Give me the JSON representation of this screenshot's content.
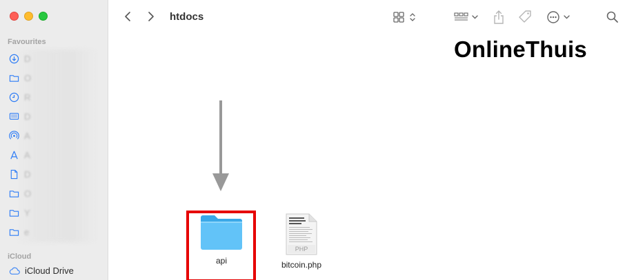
{
  "window": {
    "folder_title": "htdocs"
  },
  "sidebar": {
    "favourites_label": "Favourites",
    "items": [
      {
        "icon": "download-icon",
        "label": "D"
      },
      {
        "icon": "folder-icon",
        "label": "O"
      },
      {
        "icon": "clock-icon",
        "label": "R"
      },
      {
        "icon": "desktop-icon",
        "label": "D"
      },
      {
        "icon": "airdrop-icon",
        "label": "A"
      },
      {
        "icon": "applications-icon",
        "label": "A"
      },
      {
        "icon": "document-icon",
        "label": "D"
      },
      {
        "icon": "folder-icon",
        "label": "O"
      },
      {
        "icon": "folder-icon",
        "label": "Y"
      },
      {
        "icon": "folder-icon",
        "label": "e"
      }
    ],
    "icloud_label": "iCloud",
    "icloud_drive_label": "iCloud Drive"
  },
  "overlay": {
    "brand": "OnlineThuis"
  },
  "files": [
    {
      "name": "api",
      "type": "folder",
      "highlighted": true
    },
    {
      "name": "bitcoin.php",
      "type": "php-document",
      "thumbnail_text": "ONLINETHUIS BLOCKCHAIN NETWORK",
      "badge": "PHP"
    }
  ],
  "colors": {
    "accent": "#2d7cf6",
    "folder": "#5ac0f8",
    "highlight": "#e60000",
    "arrow": "#999999"
  }
}
